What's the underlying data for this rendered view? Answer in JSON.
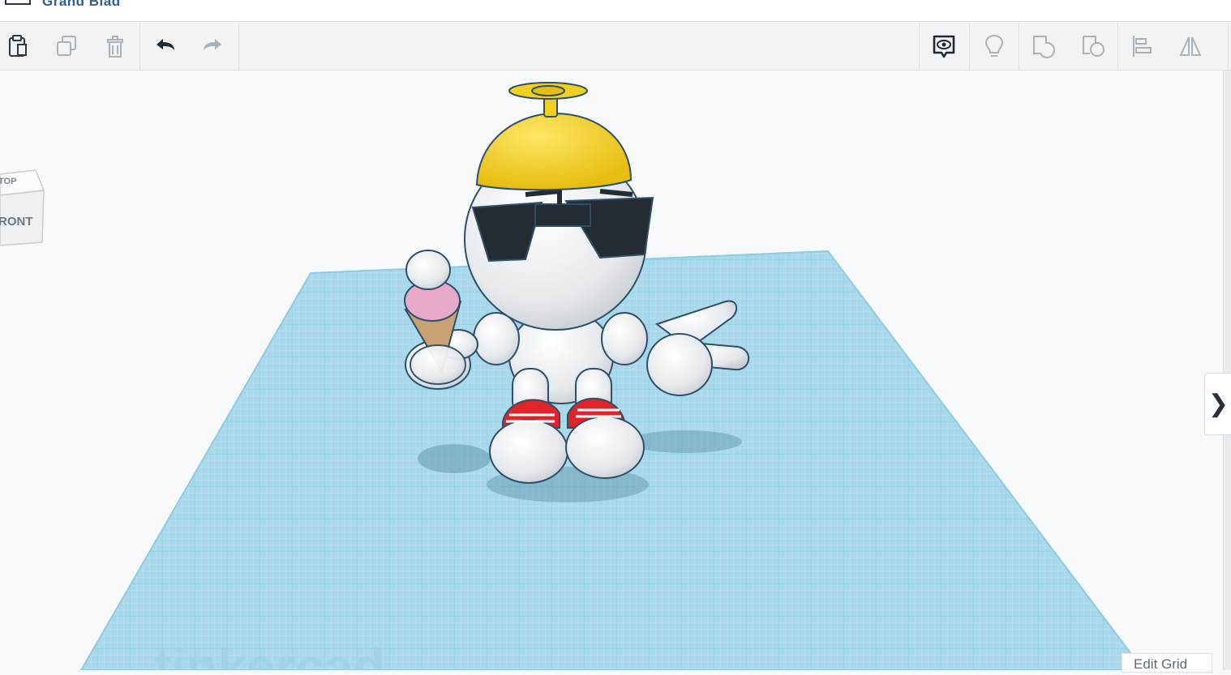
{
  "app": {
    "title": "Grand Blad"
  },
  "toolbar": {
    "left": [
      {
        "name": "paste-button",
        "icon": "clipboard-icon",
        "enabled": true
      },
      {
        "name": "duplicate-button",
        "icon": "duplicate-icon",
        "enabled": false
      },
      {
        "name": "delete-button",
        "icon": "trash-icon",
        "enabled": false
      },
      {
        "name": "undo-button",
        "icon": "undo-icon",
        "enabled": true
      },
      {
        "name": "redo-button",
        "icon": "redo-icon",
        "enabled": false
      }
    ],
    "right": [
      {
        "name": "notes-button",
        "icon": "eye-bubble-icon",
        "enabled": true
      },
      {
        "name": "light-button",
        "icon": "lightbulb-icon",
        "enabled": false
      },
      {
        "name": "group-button",
        "icon": "group-icon",
        "enabled": false
      },
      {
        "name": "ungroup-button",
        "icon": "ungroup-icon",
        "enabled": false
      },
      {
        "name": "align-button",
        "icon": "align-icon",
        "enabled": false
      },
      {
        "name": "mirror-button",
        "icon": "mirror-icon",
        "enabled": false
      }
    ]
  },
  "viewcube": {
    "top_label": "TOP",
    "front_label": "RONT"
  },
  "workplane": {
    "grid_color": "#a8d8ea",
    "watermark": "tinkercad"
  },
  "model": {
    "hat_color": "#f2d021",
    "glasses_color": "#252b33",
    "shoe_accent": "#e0242a",
    "icecream_color": "#e7a9c9",
    "cone_color": "#caa172"
  },
  "panel": {
    "toggle_icon": "chevron-right-icon",
    "toggle_glyph": "❯"
  },
  "footer": {
    "edit_grid_label": "Edit Grid"
  },
  "colors": {
    "accent": "#2f5f8f",
    "toolbar_bg": "#f2f3f5"
  }
}
